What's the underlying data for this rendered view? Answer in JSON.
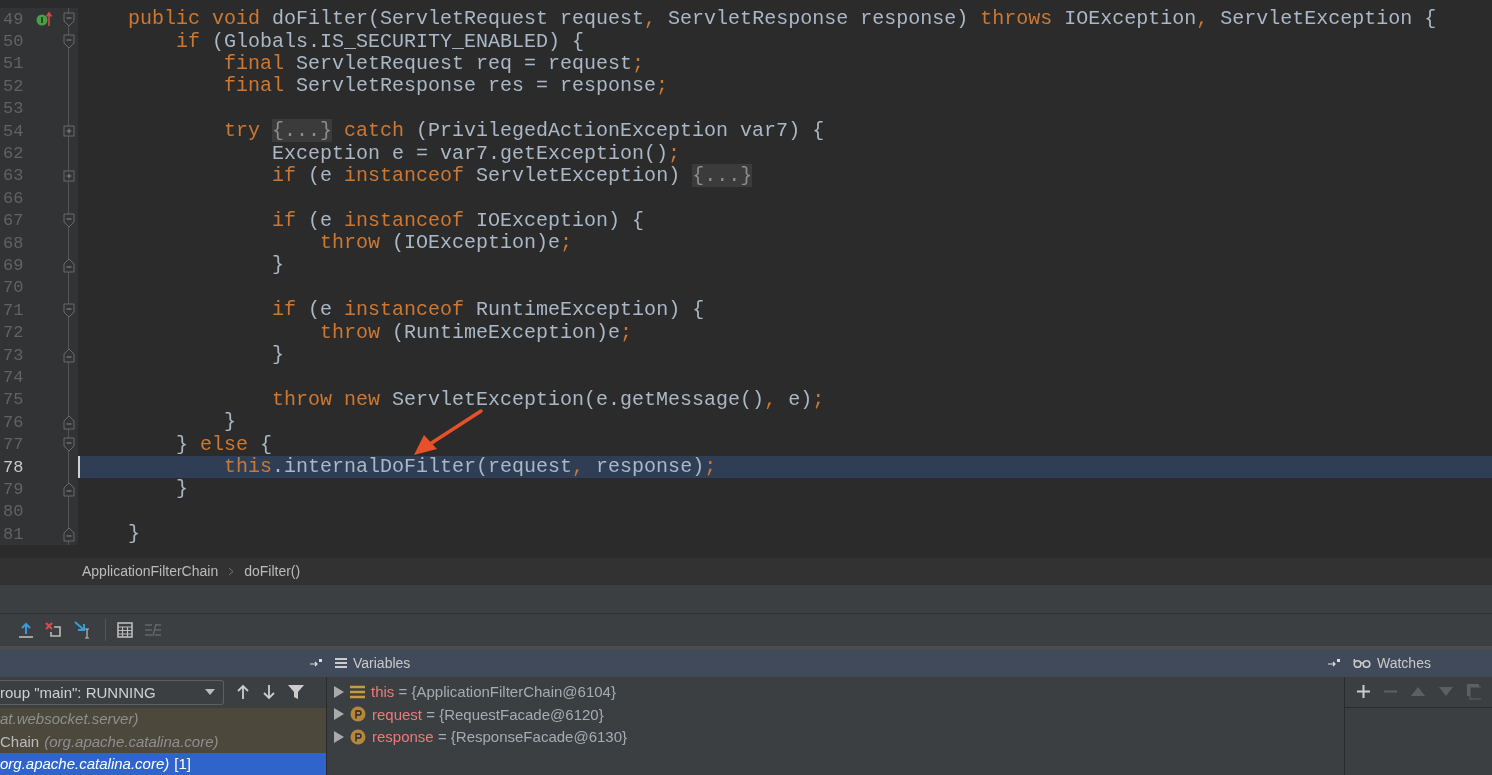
{
  "editor": {
    "lines": [
      {
        "number": "49",
        "current": false,
        "fold": {
          "kind": "open"
        },
        "gutter_icon": {
          "kind": "implements"
        },
        "tokens": [
          {
            "kind": "kw",
            "text": "    public void"
          },
          {
            "kind": "txt",
            "text": " doFilter(ServletRequest request"
          },
          {
            "kind": "op",
            "text": ","
          },
          {
            "kind": "txt",
            "text": " ServletResponse response) "
          },
          {
            "kind": "kw",
            "text": "throws"
          },
          {
            "kind": "txt",
            "text": " IOException"
          },
          {
            "kind": "op",
            "text": ","
          },
          {
            "kind": "txt",
            "text": " ServletException {"
          }
        ]
      },
      {
        "number": "50",
        "current": false,
        "fold": {
          "kind": "open"
        },
        "tokens": [
          {
            "kind": "kw",
            "text": "        if"
          },
          {
            "kind": "txt",
            "text": " (Globals.IS_SECURITY_ENABLED) {"
          }
        ]
      },
      {
        "number": "51",
        "current": false,
        "tokens": [
          {
            "kind": "kw",
            "text": "            final"
          },
          {
            "kind": "txt",
            "text": " ServletRequest req = request"
          },
          {
            "kind": "op",
            "text": ";"
          }
        ]
      },
      {
        "number": "52",
        "current": false,
        "tokens": [
          {
            "kind": "kw",
            "text": "            final"
          },
          {
            "kind": "txt",
            "text": " ServletResponse res = response"
          },
          {
            "kind": "op",
            "text": ";"
          }
        ]
      },
      {
        "number": "53",
        "current": false
      },
      {
        "number": "54",
        "current": false,
        "fold": {
          "kind": "collapsed"
        },
        "tokens": [
          {
            "kind": "kw",
            "text": "            try "
          },
          {
            "kind": "folded",
            "text": "{...}"
          },
          {
            "kind": "kw",
            "text": " catch"
          },
          {
            "kind": "txt",
            "text": " (PrivilegedActionException var7) {"
          }
        ]
      },
      {
        "number": "62",
        "current": false,
        "tokens": [
          {
            "kind": "txt",
            "text": "                Exception e = var7.getException()"
          },
          {
            "kind": "op",
            "text": ";"
          }
        ]
      },
      {
        "number": "63",
        "current": false,
        "fold": {
          "kind": "collapsed"
        },
        "tokens": [
          {
            "kind": "kw",
            "text": "                if"
          },
          {
            "kind": "txt",
            "text": " (e "
          },
          {
            "kind": "kw",
            "text": "instanceof"
          },
          {
            "kind": "txt",
            "text": " ServletException) "
          },
          {
            "kind": "folded",
            "text": "{...}"
          }
        ]
      },
      {
        "number": "66",
        "current": false
      },
      {
        "number": "67",
        "current": false,
        "fold": {
          "kind": "open"
        },
        "tokens": [
          {
            "kind": "kw",
            "text": "                if"
          },
          {
            "kind": "txt",
            "text": " (e "
          },
          {
            "kind": "kw",
            "text": "instanceof"
          },
          {
            "kind": "txt",
            "text": " IOException) {"
          }
        ]
      },
      {
        "number": "68",
        "current": false,
        "tokens": [
          {
            "kind": "kw",
            "text": "                    throw"
          },
          {
            "kind": "txt",
            "text": " (IOException)e"
          },
          {
            "kind": "op",
            "text": ";"
          }
        ]
      },
      {
        "number": "69",
        "current": false,
        "fold": {
          "kind": "close"
        },
        "tokens": [
          {
            "kind": "txt",
            "text": "                }"
          }
        ]
      },
      {
        "number": "70",
        "current": false
      },
      {
        "number": "71",
        "current": false,
        "fold": {
          "kind": "open"
        },
        "tokens": [
          {
            "kind": "kw",
            "text": "                if"
          },
          {
            "kind": "txt",
            "text": " (e "
          },
          {
            "kind": "kw",
            "text": "instanceof"
          },
          {
            "kind": "txt",
            "text": " RuntimeException) {"
          }
        ]
      },
      {
        "number": "72",
        "current": false,
        "tokens": [
          {
            "kind": "kw",
            "text": "                    throw"
          },
          {
            "kind": "txt",
            "text": " (RuntimeException)e"
          },
          {
            "kind": "op",
            "text": ";"
          }
        ]
      },
      {
        "number": "73",
        "current": false,
        "fold": {
          "kind": "close"
        },
        "tokens": [
          {
            "kind": "txt",
            "text": "                }"
          }
        ]
      },
      {
        "number": "74",
        "current": false
      },
      {
        "number": "75",
        "current": false,
        "tokens": [
          {
            "kind": "kw",
            "text": "                throw new"
          },
          {
            "kind": "txt",
            "text": " ServletException(e.getMessage()"
          },
          {
            "kind": "op",
            "text": ","
          },
          {
            "kind": "txt",
            "text": " e)"
          },
          {
            "kind": "op",
            "text": ";"
          }
        ]
      },
      {
        "number": "76",
        "current": false,
        "fold": {
          "kind": "close"
        },
        "tokens": [
          {
            "kind": "txt",
            "text": "            }"
          }
        ]
      },
      {
        "number": "77",
        "current": false,
        "fold": {
          "kind": "open"
        },
        "tokens": [
          {
            "kind": "txt",
            "text": "        } "
          },
          {
            "kind": "kw",
            "text": "else"
          },
          {
            "kind": "txt",
            "text": " {"
          }
        ]
      },
      {
        "number": "78",
        "current": true,
        "tokens": [
          {
            "kind": "kw",
            "text": "            this"
          },
          {
            "kind": "txt",
            "text": ".internalDoFilter(request"
          },
          {
            "kind": "op",
            "text": ","
          },
          {
            "kind": "txt",
            "text": " response)"
          },
          {
            "kind": "op",
            "text": ";"
          }
        ]
      },
      {
        "number": "79",
        "current": false,
        "fold": {
          "kind": "close"
        },
        "tokens": [
          {
            "kind": "txt",
            "text": "        }"
          }
        ]
      },
      {
        "number": "80",
        "current": false
      },
      {
        "number": "81",
        "current": false,
        "fold": {
          "kind": "close"
        },
        "tokens": [
          {
            "kind": "txt",
            "text": "    }"
          }
        ]
      }
    ]
  },
  "breadcrumbs": [
    "ApplicationFilterChain",
    "doFilter()"
  ],
  "frames_panel": {
    "thread_dropdown": "roup \"main\": RUNNING",
    "frames": [
      {
        "package": "at.websocket.server)",
        "selected": false
      },
      {
        "method": "Chain",
        "package": "(org.apache.catalina.core)",
        "selected": false
      },
      {
        "package": "org.apache.catalina.core)",
        "suffix": "[1]",
        "selected": true
      }
    ]
  },
  "variables_panel": {
    "title": "Variables",
    "variables": [
      {
        "kind": "object",
        "name": "this",
        "value": "= {ApplicationFilterChain@6104}",
        "expanded": false
      },
      {
        "kind": "param",
        "name": "request",
        "value": "= {RequestFacade@6120}",
        "expanded": false
      },
      {
        "kind": "param",
        "name": "response",
        "value": "= {ResponseFacade@6130}",
        "expanded": false
      }
    ]
  },
  "watches_panel": {
    "title": "Watches"
  }
}
